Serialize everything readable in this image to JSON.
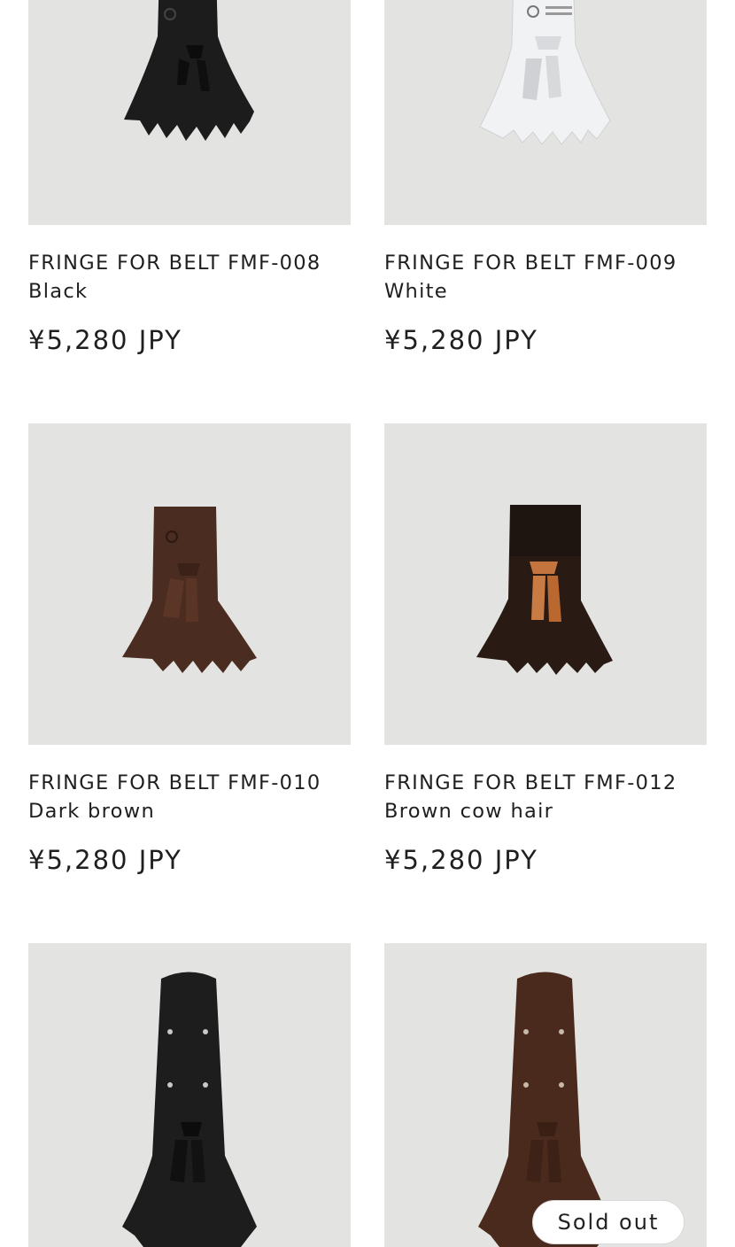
{
  "products": [
    {
      "name_line1": "FRINGE FOR BELT FMF-008",
      "name_line2": "Black",
      "price": "¥5,280 JPY",
      "color": "#1c1c1c"
    },
    {
      "name_line1": "FRINGE FOR BELT FMF-009",
      "name_line2": "White",
      "price": "¥5,280 JPY",
      "color": "#f1f2f4"
    },
    {
      "name_line1": "FRINGE FOR BELT FMF-010",
      "name_line2": "Dark brown",
      "price": "¥5,280 JPY",
      "color": "#4b2c20"
    },
    {
      "name_line1": "FRINGE FOR BELT FMF-012",
      "name_line2": "Brown cow hair",
      "price": "¥5,280 JPY",
      "color": "#2a1a14"
    },
    {
      "color": "#1d1d1d"
    },
    {
      "color": "#4a2a1c",
      "badge": "Sold out"
    }
  ],
  "image_background": "#e3e3e1"
}
